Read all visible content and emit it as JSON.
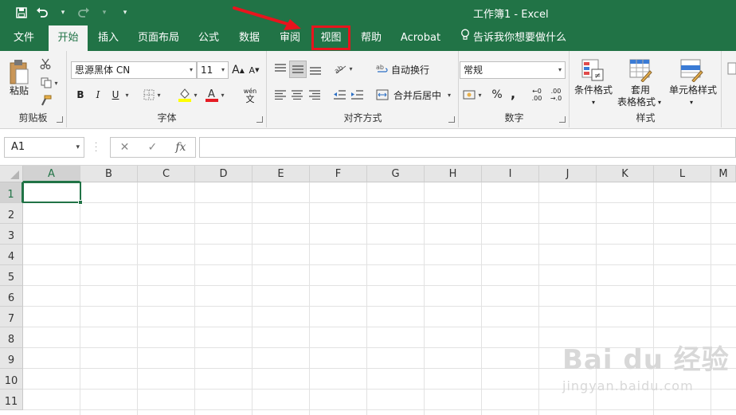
{
  "window": {
    "title": "工作簿1  -  Excel",
    "quick_access": {
      "more": "▾"
    }
  },
  "tabs": [
    {
      "label": "文件",
      "active": false
    },
    {
      "label": "开始",
      "active": true
    },
    {
      "label": "插入",
      "active": false
    },
    {
      "label": "页面布局",
      "active": false
    },
    {
      "label": "公式",
      "active": false
    },
    {
      "label": "数据",
      "active": false
    },
    {
      "label": "审阅",
      "active": false
    },
    {
      "label": "视图",
      "active": false,
      "highlighted": true
    },
    {
      "label": "帮助",
      "active": false
    },
    {
      "label": "Acrobat",
      "active": false
    }
  ],
  "tell_me": {
    "label": "告诉我你想要做什么"
  },
  "ribbon": {
    "clipboard": {
      "label": "剪贴板",
      "paste_label": "粘贴"
    },
    "font": {
      "label": "字体",
      "font_name": "思源黑体 CN",
      "font_size": "11",
      "bold": "B",
      "italic": "I",
      "underline": "U",
      "grow": "A",
      "shrink": "A",
      "pinyin_top": "wén",
      "pinyin_bottom": "文"
    },
    "alignment": {
      "label": "对齐方式",
      "wrap_text": "自动换行",
      "merge_center": "合并后居中"
    },
    "number": {
      "label": "数字",
      "format": "常规",
      "percent": "%",
      "comma": ",",
      "inc_decimal_top": "←0",
      "inc_decimal_bottom": ".00",
      "dec_decimal_top": ".00",
      "dec_decimal_bottom": "→.0"
    },
    "styles": {
      "label": "样式",
      "conditional": "条件格式",
      "table_line1": "套用",
      "table_line2": "表格格式",
      "cell_styles": "单元格样式"
    }
  },
  "formula_bar": {
    "name_box": "A1",
    "cancel": "✕",
    "enter": "✓",
    "fx": "fx"
  },
  "sheet": {
    "columns": [
      "A",
      "B",
      "C",
      "D",
      "E",
      "F",
      "G",
      "H",
      "I",
      "J",
      "K",
      "L",
      "M"
    ],
    "rows": [
      "1",
      "2",
      "3",
      "4",
      "5",
      "6",
      "7",
      "8",
      "9",
      "10",
      "11"
    ],
    "active_cell": "A1"
  },
  "watermark": {
    "line1": "Bai du 经验",
    "line2": "jingyan.baidu.com"
  },
  "colors": {
    "accent": "#217346",
    "highlight": "#e8141d",
    "ribbon_bg": "#f3f3f3"
  }
}
